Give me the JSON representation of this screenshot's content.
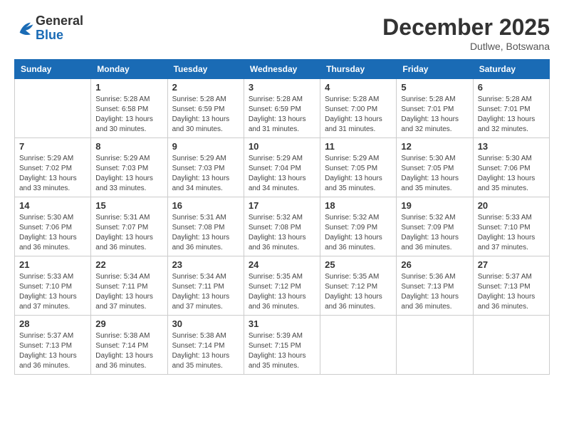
{
  "header": {
    "logo_general": "General",
    "logo_blue": "Blue",
    "month_title": "December 2025",
    "location": "Dutlwe, Botswana"
  },
  "calendar": {
    "days_of_week": [
      "Sunday",
      "Monday",
      "Tuesday",
      "Wednesday",
      "Thursday",
      "Friday",
      "Saturday"
    ],
    "weeks": [
      [
        {
          "day": "",
          "info": ""
        },
        {
          "day": "1",
          "info": "Sunrise: 5:28 AM\nSunset: 6:58 PM\nDaylight: 13 hours\nand 30 minutes."
        },
        {
          "day": "2",
          "info": "Sunrise: 5:28 AM\nSunset: 6:59 PM\nDaylight: 13 hours\nand 30 minutes."
        },
        {
          "day": "3",
          "info": "Sunrise: 5:28 AM\nSunset: 6:59 PM\nDaylight: 13 hours\nand 31 minutes."
        },
        {
          "day": "4",
          "info": "Sunrise: 5:28 AM\nSunset: 7:00 PM\nDaylight: 13 hours\nand 31 minutes."
        },
        {
          "day": "5",
          "info": "Sunrise: 5:28 AM\nSunset: 7:01 PM\nDaylight: 13 hours\nand 32 minutes."
        },
        {
          "day": "6",
          "info": "Sunrise: 5:28 AM\nSunset: 7:01 PM\nDaylight: 13 hours\nand 32 minutes."
        }
      ],
      [
        {
          "day": "7",
          "info": "Sunrise: 5:29 AM\nSunset: 7:02 PM\nDaylight: 13 hours\nand 33 minutes."
        },
        {
          "day": "8",
          "info": "Sunrise: 5:29 AM\nSunset: 7:03 PM\nDaylight: 13 hours\nand 33 minutes."
        },
        {
          "day": "9",
          "info": "Sunrise: 5:29 AM\nSunset: 7:03 PM\nDaylight: 13 hours\nand 34 minutes."
        },
        {
          "day": "10",
          "info": "Sunrise: 5:29 AM\nSunset: 7:04 PM\nDaylight: 13 hours\nand 34 minutes."
        },
        {
          "day": "11",
          "info": "Sunrise: 5:29 AM\nSunset: 7:05 PM\nDaylight: 13 hours\nand 35 minutes."
        },
        {
          "day": "12",
          "info": "Sunrise: 5:30 AM\nSunset: 7:05 PM\nDaylight: 13 hours\nand 35 minutes."
        },
        {
          "day": "13",
          "info": "Sunrise: 5:30 AM\nSunset: 7:06 PM\nDaylight: 13 hours\nand 35 minutes."
        }
      ],
      [
        {
          "day": "14",
          "info": "Sunrise: 5:30 AM\nSunset: 7:06 PM\nDaylight: 13 hours\nand 36 minutes."
        },
        {
          "day": "15",
          "info": "Sunrise: 5:31 AM\nSunset: 7:07 PM\nDaylight: 13 hours\nand 36 minutes."
        },
        {
          "day": "16",
          "info": "Sunrise: 5:31 AM\nSunset: 7:08 PM\nDaylight: 13 hours\nand 36 minutes."
        },
        {
          "day": "17",
          "info": "Sunrise: 5:32 AM\nSunset: 7:08 PM\nDaylight: 13 hours\nand 36 minutes."
        },
        {
          "day": "18",
          "info": "Sunrise: 5:32 AM\nSunset: 7:09 PM\nDaylight: 13 hours\nand 36 minutes."
        },
        {
          "day": "19",
          "info": "Sunrise: 5:32 AM\nSunset: 7:09 PM\nDaylight: 13 hours\nand 36 minutes."
        },
        {
          "day": "20",
          "info": "Sunrise: 5:33 AM\nSunset: 7:10 PM\nDaylight: 13 hours\nand 37 minutes."
        }
      ],
      [
        {
          "day": "21",
          "info": "Sunrise: 5:33 AM\nSunset: 7:10 PM\nDaylight: 13 hours\nand 37 minutes."
        },
        {
          "day": "22",
          "info": "Sunrise: 5:34 AM\nSunset: 7:11 PM\nDaylight: 13 hours\nand 37 minutes."
        },
        {
          "day": "23",
          "info": "Sunrise: 5:34 AM\nSunset: 7:11 PM\nDaylight: 13 hours\nand 37 minutes."
        },
        {
          "day": "24",
          "info": "Sunrise: 5:35 AM\nSunset: 7:12 PM\nDaylight: 13 hours\nand 36 minutes."
        },
        {
          "day": "25",
          "info": "Sunrise: 5:35 AM\nSunset: 7:12 PM\nDaylight: 13 hours\nand 36 minutes."
        },
        {
          "day": "26",
          "info": "Sunrise: 5:36 AM\nSunset: 7:13 PM\nDaylight: 13 hours\nand 36 minutes."
        },
        {
          "day": "27",
          "info": "Sunrise: 5:37 AM\nSunset: 7:13 PM\nDaylight: 13 hours\nand 36 minutes."
        }
      ],
      [
        {
          "day": "28",
          "info": "Sunrise: 5:37 AM\nSunset: 7:13 PM\nDaylight: 13 hours\nand 36 minutes."
        },
        {
          "day": "29",
          "info": "Sunrise: 5:38 AM\nSunset: 7:14 PM\nDaylight: 13 hours\nand 36 minutes."
        },
        {
          "day": "30",
          "info": "Sunrise: 5:38 AM\nSunset: 7:14 PM\nDaylight: 13 hours\nand 35 minutes."
        },
        {
          "day": "31",
          "info": "Sunrise: 5:39 AM\nSunset: 7:15 PM\nDaylight: 13 hours\nand 35 minutes."
        },
        {
          "day": "",
          "info": ""
        },
        {
          "day": "",
          "info": ""
        },
        {
          "day": "",
          "info": ""
        }
      ]
    ]
  }
}
